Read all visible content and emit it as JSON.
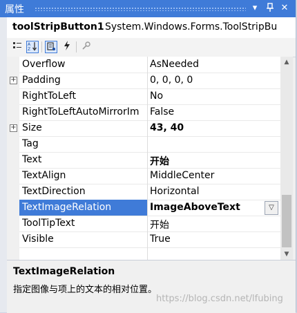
{
  "window": {
    "title": "属性",
    "buttons": {
      "pin": "▾",
      "autohide": "📌",
      "close": "✕"
    }
  },
  "object": {
    "name": "toolStripButton1",
    "type": "System.Windows.Forms.ToolStripBu"
  },
  "toolbar": {
    "icons": [
      "categorized-icon",
      "alphabetical-icon",
      "properties-icon",
      "events-icon",
      "property-pages-icon"
    ]
  },
  "properties": [
    {
      "name": "Overflow",
      "value": "AsNeeded",
      "expandable": false,
      "bold": false
    },
    {
      "name": "Padding",
      "value": "0, 0, 0, 0",
      "expandable": true,
      "bold": false
    },
    {
      "name": "RightToLeft",
      "value": "No",
      "expandable": false,
      "bold": false
    },
    {
      "name": "RightToLeftAutoMirrorIm",
      "value": "False",
      "expandable": false,
      "bold": false
    },
    {
      "name": "Size",
      "value": "43, 40",
      "expandable": true,
      "bold": true
    },
    {
      "name": "Tag",
      "value": "",
      "expandable": false,
      "bold": false
    },
    {
      "name": "Text",
      "value": "开始",
      "expandable": false,
      "bold": true
    },
    {
      "name": "TextAlign",
      "value": "MiddleCenter",
      "expandable": false,
      "bold": false
    },
    {
      "name": "TextDirection",
      "value": "Horizontal",
      "expandable": false,
      "bold": false
    },
    {
      "name": "TextImageRelation",
      "value": "ImageAboveText",
      "expandable": false,
      "bold": true,
      "selected": true
    },
    {
      "name": "ToolTipText",
      "value": "开始",
      "expandable": false,
      "bold": false
    },
    {
      "name": "Visible",
      "value": "True",
      "expandable": false,
      "bold": false
    }
  ],
  "description": {
    "title": "TextImageRelation",
    "text": "指定图像与项上的文本的相对位置。"
  },
  "watermark": "https://blog.csdn.net/lfubing",
  "colors": {
    "accent": "#3f7bd8",
    "panel": "#f0f0f0"
  }
}
